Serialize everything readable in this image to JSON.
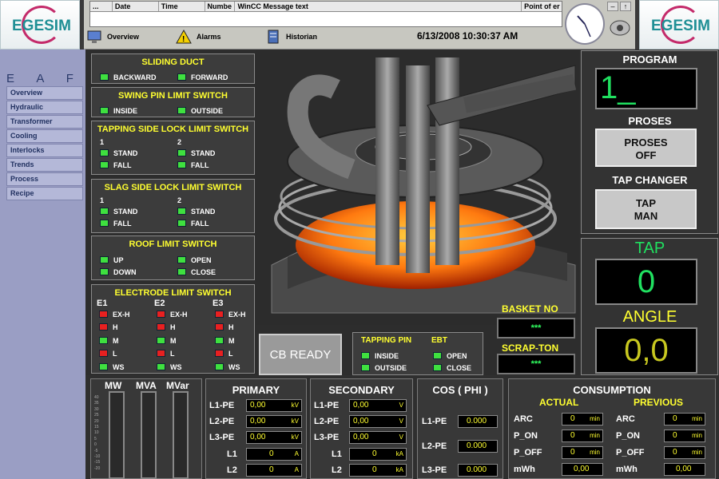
{
  "app": {
    "logo_text": "EGESIM",
    "plant_label": "E A F"
  },
  "messages": {
    "columns": [
      "...",
      "Date",
      "Time",
      "Numbe",
      "WinCC Message text",
      "Point of er"
    ]
  },
  "toolbar": {
    "overview": "Overview",
    "alarms": "Alarms",
    "historian": "Historian",
    "datetime": "6/13/2008 10:30:37 AM"
  },
  "nav": [
    "Overview",
    "Hydraulic",
    "Transformer",
    "Cooling",
    "Interlocks",
    "Trends",
    "Process",
    "Recipe"
  ],
  "panels": {
    "sliding_duct": {
      "title": "SLIDING DUCT",
      "a": "BACKWARD",
      "b": "FORWARD"
    },
    "swing_pin": {
      "title": "SWING PIN LIMIT SWITCH",
      "a": "INSIDE",
      "b": "OUTSIDE"
    },
    "tapping_lock": {
      "title": "TAPPING SIDE LOCK LIMIT SWITCH",
      "c1": "1",
      "c2": "2",
      "stand": "STAND",
      "fall": "FALL"
    },
    "slag_lock": {
      "title": "SLAG SIDE LOCK LIMIT SWITCH",
      "c1": "1",
      "c2": "2",
      "stand": "STAND",
      "fall": "FALL"
    },
    "roof": {
      "title": "ROOF LIMIT SWITCH",
      "up": "UP",
      "down": "DOWN",
      "open": "OPEN",
      "close": "CLOSE"
    },
    "electrode": {
      "title": "ELECTRODE LIMIT SWITCH",
      "e1": "E1",
      "e2": "E2",
      "e3": "E3",
      "exh": "EX-H",
      "h": "H",
      "m": "M",
      "l": "L",
      "ws": "WS"
    },
    "tapping_pin": {
      "title": "TAPPING PIN",
      "inside": "INSIDE",
      "outside": "OUTSIDE"
    },
    "ebt": {
      "title": "EBT",
      "open": "OPEN",
      "close": "CLOSE"
    }
  },
  "cb_ready": "CB READY",
  "basket": {
    "label": "BASKET NO",
    "value": "***"
  },
  "scrap": {
    "label": "SCRAP-TON",
    "value": "***"
  },
  "right": {
    "program_label": "PROGRAM",
    "program_value": "1_",
    "proses_label": "PROSES",
    "proses_btn_line1": "PROSES",
    "proses_btn_line2": "OFF",
    "tap_changer_label": "TAP CHANGER",
    "tap_btn_line1": "TAP",
    "tap_btn_line2": "MAN",
    "tap_label": "TAP",
    "tap_value": "0",
    "angle_label": "ANGLE",
    "angle_value": "0,0"
  },
  "bars": {
    "mw": "MW",
    "mva": "MVA",
    "mvar": "MVar",
    "scale": [
      "40",
      "35",
      "30",
      "25",
      "20",
      "15",
      "10",
      "5",
      "0",
      "-5",
      "-10",
      "-15",
      "-20"
    ]
  },
  "primary": {
    "title": "PRIMARY",
    "rows": [
      {
        "label": "L1-PE",
        "value": "0,00",
        "unit": "kV"
      },
      {
        "label": "L2-PE",
        "value": "0,00",
        "unit": "kV"
      },
      {
        "label": "L3-PE",
        "value": "0,00",
        "unit": "kV"
      },
      {
        "label": "L1",
        "value": "0",
        "unit": "A"
      },
      {
        "label": "L2",
        "value": "0",
        "unit": "A"
      }
    ]
  },
  "secondary": {
    "title": "SECONDARY",
    "rows": [
      {
        "label": "L1-PE",
        "value": "0,00",
        "unit": "V"
      },
      {
        "label": "L2-PE",
        "value": "0,00",
        "unit": "V"
      },
      {
        "label": "L3-PE",
        "value": "0,00",
        "unit": "V"
      },
      {
        "label": "L1",
        "value": "0",
        "unit": "kA"
      },
      {
        "label": "L2",
        "value": "0",
        "unit": "kA"
      }
    ]
  },
  "cos": {
    "title": "COS ( PHI )",
    "rows": [
      {
        "label": "L1-PE",
        "value": "0.000"
      },
      {
        "label": "L2-PE",
        "value": "0.000"
      },
      {
        "label": "L3-PE",
        "value": "0.000"
      }
    ]
  },
  "consumption": {
    "title": "CONSUMPTION",
    "actual": "ACTUAL",
    "previous": "PREVIOUS",
    "rows": [
      {
        "label": "ARC",
        "actual": "0",
        "previous": "0",
        "unit": "min"
      },
      {
        "label": "P_ON",
        "actual": "0",
        "previous": "0",
        "unit": "min"
      },
      {
        "label": "P_OFF",
        "actual": "0",
        "previous": "0",
        "unit": "min"
      },
      {
        "label": "mWh",
        "actual": "0,00",
        "previous": "0,00",
        "unit": ""
      }
    ]
  }
}
